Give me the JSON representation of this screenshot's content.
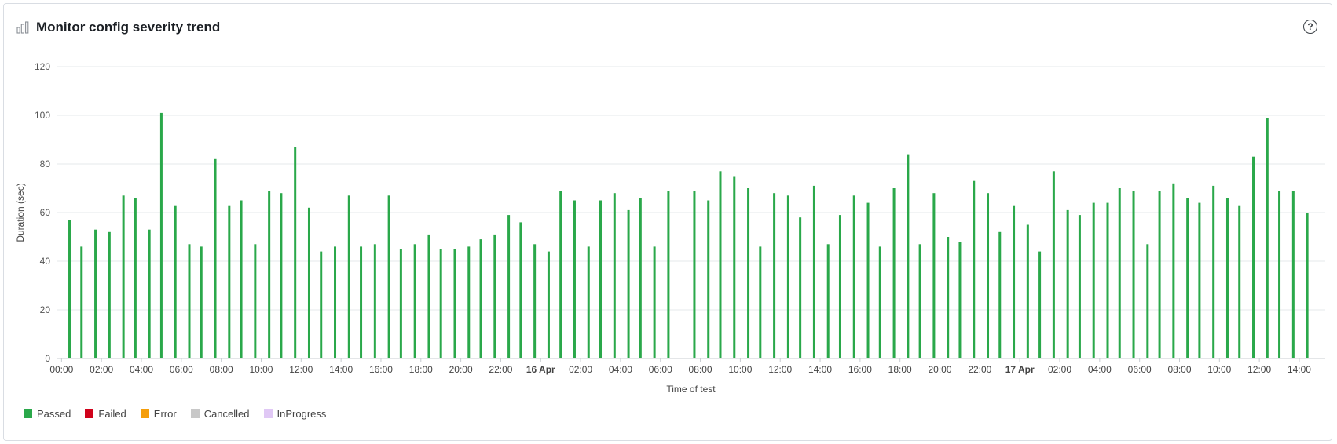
{
  "title": "Monitor config severity trend",
  "help_symbol": "?",
  "icons": {
    "chart": "bar-chart-icon",
    "help": "help-icon"
  },
  "colors": {
    "passed": "#2aa84a",
    "failed": "#d0021b",
    "error": "#f59e0b",
    "cancelled": "#c8c8c8",
    "inprogress": "#e0c8f5"
  },
  "chart_data": {
    "type": "bar",
    "title": "Monitor config severity trend",
    "xlabel": "Time of test",
    "ylabel": "Duration (sec)",
    "ylim": [
      0,
      120
    ],
    "yticks": [
      0,
      20,
      40,
      60,
      80,
      100,
      120
    ],
    "grid": true,
    "legend_position": "bottom-left",
    "x_tick_labels": [
      {
        "label": "00:00",
        "bold": false
      },
      {
        "label": "02:00",
        "bold": false
      },
      {
        "label": "04:00",
        "bold": false
      },
      {
        "label": "06:00",
        "bold": false
      },
      {
        "label": "08:00",
        "bold": false
      },
      {
        "label": "10:00",
        "bold": false
      },
      {
        "label": "12:00",
        "bold": false
      },
      {
        "label": "14:00",
        "bold": false
      },
      {
        "label": "16:00",
        "bold": false
      },
      {
        "label": "18:00",
        "bold": false
      },
      {
        "label": "20:00",
        "bold": false
      },
      {
        "label": "22:00",
        "bold": false
      },
      {
        "label": "16 Apr",
        "bold": true
      },
      {
        "label": "02:00",
        "bold": false
      },
      {
        "label": "04:00",
        "bold": false
      },
      {
        "label": "06:00",
        "bold": false
      },
      {
        "label": "08:00",
        "bold": false
      },
      {
        "label": "10:00",
        "bold": false
      },
      {
        "label": "12:00",
        "bold": false
      },
      {
        "label": "14:00",
        "bold": false
      },
      {
        "label": "16:00",
        "bold": false
      },
      {
        "label": "18:00",
        "bold": false
      },
      {
        "label": "20:00",
        "bold": false
      },
      {
        "label": "22:00",
        "bold": false
      },
      {
        "label": "17 Apr",
        "bold": true
      },
      {
        "label": "02:00",
        "bold": false
      },
      {
        "label": "04:00",
        "bold": false
      },
      {
        "label": "06:00",
        "bold": false
      },
      {
        "label": "08:00",
        "bold": false
      },
      {
        "label": "10:00",
        "bold": false
      },
      {
        "label": "12:00",
        "bold": false
      },
      {
        "label": "14:00",
        "bold": false
      }
    ],
    "x_range_hours": [
      -0.25,
      63.3
    ],
    "series": [
      {
        "name": "Passed",
        "color": "#2aa84a",
        "points": [
          {
            "h": 0.4,
            "v": 57
          },
          {
            "h": 1.0,
            "v": 46
          },
          {
            "h": 1.7,
            "v": 53
          },
          {
            "h": 2.4,
            "v": 52
          },
          {
            "h": 3.1,
            "v": 67
          },
          {
            "h": 3.7,
            "v": 66
          },
          {
            "h": 4.4,
            "v": 53
          },
          {
            "h": 5.0,
            "v": 101
          },
          {
            "h": 5.7,
            "v": 63
          },
          {
            "h": 6.4,
            "v": 47
          },
          {
            "h": 7.0,
            "v": 46
          },
          {
            "h": 7.7,
            "v": 82
          },
          {
            "h": 8.4,
            "v": 63
          },
          {
            "h": 9.0,
            "v": 65
          },
          {
            "h": 9.7,
            "v": 47
          },
          {
            "h": 10.4,
            "v": 69
          },
          {
            "h": 11.0,
            "v": 68
          },
          {
            "h": 11.7,
            "v": 87
          },
          {
            "h": 12.4,
            "v": 62
          },
          {
            "h": 13.0,
            "v": 44
          },
          {
            "h": 13.7,
            "v": 46
          },
          {
            "h": 14.4,
            "v": 67
          },
          {
            "h": 15.0,
            "v": 46
          },
          {
            "h": 15.7,
            "v": 47
          },
          {
            "h": 16.4,
            "v": 67
          },
          {
            "h": 17.0,
            "v": 45
          },
          {
            "h": 17.7,
            "v": 47
          },
          {
            "h": 18.4,
            "v": 51
          },
          {
            "h": 19.0,
            "v": 45
          },
          {
            "h": 19.7,
            "v": 45
          },
          {
            "h": 20.4,
            "v": 46
          },
          {
            "h": 21.0,
            "v": 49
          },
          {
            "h": 21.7,
            "v": 51
          },
          {
            "h": 22.4,
            "v": 59
          },
          {
            "h": 23.0,
            "v": 56
          },
          {
            "h": 23.7,
            "v": 47
          },
          {
            "h": 24.4,
            "v": 44
          },
          {
            "h": 25.0,
            "v": 69
          },
          {
            "h": 25.7,
            "v": 65
          },
          {
            "h": 26.4,
            "v": 46
          },
          {
            "h": 27.0,
            "v": 65
          },
          {
            "h": 27.7,
            "v": 68
          },
          {
            "h": 28.4,
            "v": 61
          },
          {
            "h": 29.0,
            "v": 66
          },
          {
            "h": 29.7,
            "v": 46
          },
          {
            "h": 30.4,
            "v": 69
          },
          {
            "h": 31.7,
            "v": 69
          },
          {
            "h": 32.4,
            "v": 65
          },
          {
            "h": 33.0,
            "v": 77
          },
          {
            "h": 33.7,
            "v": 75
          },
          {
            "h": 34.4,
            "v": 70
          },
          {
            "h": 35.0,
            "v": 46
          },
          {
            "h": 35.7,
            "v": 68
          },
          {
            "h": 36.4,
            "v": 67
          },
          {
            "h": 37.0,
            "v": 58
          },
          {
            "h": 37.7,
            "v": 71
          },
          {
            "h": 38.4,
            "v": 47
          },
          {
            "h": 39.0,
            "v": 59
          },
          {
            "h": 39.7,
            "v": 67
          },
          {
            "h": 40.4,
            "v": 64
          },
          {
            "h": 41.0,
            "v": 46
          },
          {
            "h": 41.7,
            "v": 70
          },
          {
            "h": 42.4,
            "v": 84
          },
          {
            "h": 43.0,
            "v": 47
          },
          {
            "h": 43.7,
            "v": 68
          },
          {
            "h": 44.4,
            "v": 50
          },
          {
            "h": 45.0,
            "v": 48
          },
          {
            "h": 45.7,
            "v": 73
          },
          {
            "h": 46.4,
            "v": 68
          },
          {
            "h": 47.0,
            "v": 52
          },
          {
            "h": 47.7,
            "v": 63
          },
          {
            "h": 48.4,
            "v": 55
          },
          {
            "h": 49.0,
            "v": 44
          },
          {
            "h": 49.7,
            "v": 77
          },
          {
            "h": 50.4,
            "v": 61
          },
          {
            "h": 51.0,
            "v": 59
          },
          {
            "h": 51.7,
            "v": 64
          },
          {
            "h": 52.4,
            "v": 64
          },
          {
            "h": 53.0,
            "v": 70
          },
          {
            "h": 53.7,
            "v": 69
          },
          {
            "h": 54.4,
            "v": 47
          },
          {
            "h": 55.0,
            "v": 69
          },
          {
            "h": 55.7,
            "v": 72
          },
          {
            "h": 56.4,
            "v": 66
          },
          {
            "h": 57.0,
            "v": 64
          },
          {
            "h": 57.7,
            "v": 71
          },
          {
            "h": 58.4,
            "v": 66
          },
          {
            "h": 59.0,
            "v": 63
          },
          {
            "h": 59.7,
            "v": 83
          },
          {
            "h": 60.4,
            "v": 99
          },
          {
            "h": 61.0,
            "v": 69
          },
          {
            "h": 61.7,
            "v": 69
          },
          {
            "h": 62.4,
            "v": 60
          }
        ]
      }
    ]
  },
  "legend": [
    {
      "label": "Passed",
      "color": "#2aa84a"
    },
    {
      "label": "Failed",
      "color": "#d0021b"
    },
    {
      "label": "Error",
      "color": "#f59e0b"
    },
    {
      "label": "Cancelled",
      "color": "#c8c8c8"
    },
    {
      "label": "InProgress",
      "color": "#e0c8f5"
    }
  ]
}
